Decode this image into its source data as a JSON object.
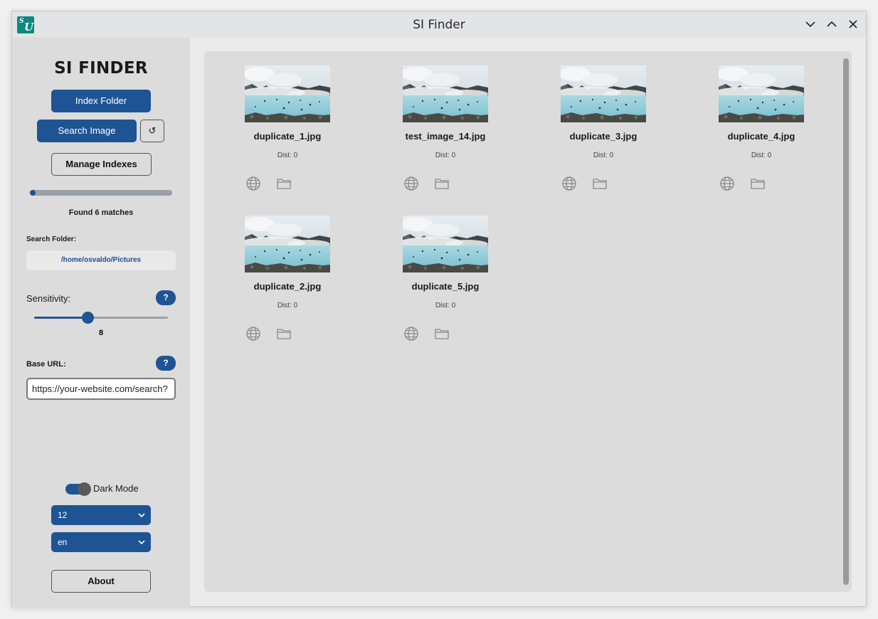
{
  "window": {
    "title": "SI Finder"
  },
  "sidebar": {
    "brand": "SI FINDER",
    "index_folder_label": "Index Folder",
    "search_image_label": "Search Image",
    "reset_label": "↺",
    "manage_indexes_label": "Manage Indexes",
    "progress": 0.02,
    "status": "Found 6 matches",
    "search_folder_label": "Search Folder:",
    "search_folder_value": "/home/osvaldo/Pictures",
    "sensitivity_label": "Sensitivity:",
    "sensitivity_value": "8",
    "sensitivity_fraction": 0.4,
    "help_label": "?",
    "base_url_label": "Base URL:",
    "base_url_value": "https://your-website.com/search?",
    "dark_mode_label": "Dark Mode",
    "dark_mode_on": true,
    "size_select": "12",
    "lang_select": "en",
    "about_label": "About"
  },
  "colors": {
    "accent": "#1f5494",
    "app_icon": "#0a8a80"
  },
  "results": [
    {
      "name": "duplicate_1.jpg",
      "dist": "Dist: 0"
    },
    {
      "name": "test_image_14.jpg",
      "dist": "Dist: 0"
    },
    {
      "name": "duplicate_3.jpg",
      "dist": "Dist: 0"
    },
    {
      "name": "duplicate_4.jpg",
      "dist": "Dist: 0"
    },
    {
      "name": "duplicate_2.jpg",
      "dist": "Dist: 0"
    },
    {
      "name": "duplicate_5.jpg",
      "dist": "Dist: 0"
    }
  ]
}
